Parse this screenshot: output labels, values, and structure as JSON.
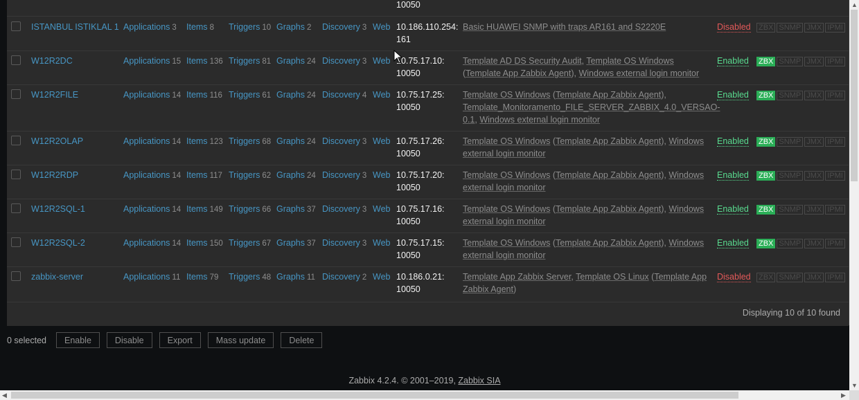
{
  "top_fragment": "10050",
  "rows": [
    {
      "name": "ISTANBUL ISTIKLAL 1",
      "apps": "3",
      "items": "8",
      "triggers": "10",
      "graphs": "2",
      "discovery": "3",
      "ip1": "10.186.110.254:",
      "ip2": "161",
      "templates": [
        {
          "text": "Basic HUAWEI SNMP with traps AR161 and S2220E",
          "link": true
        }
      ],
      "status": "Disabled",
      "zbx": false
    },
    {
      "name": "W12R2DC",
      "apps": "15",
      "items": "136",
      "triggers": "81",
      "graphs": "24",
      "discovery": "3",
      "ip1": "10.75.17.10:",
      "ip2": "10050",
      "templates": [
        {
          "text": "Template AD DS Security Audit",
          "link": true
        },
        {
          "text": ", ",
          "link": false
        },
        {
          "text": "Template OS Windows",
          "link": true
        },
        {
          "text": " (",
          "link": false
        },
        {
          "text": "Template App Zabbix Agent",
          "link": true
        },
        {
          "text": "), ",
          "link": false
        },
        {
          "text": "Windows external login monitor",
          "link": true
        }
      ],
      "status": "Enabled",
      "zbx": true
    },
    {
      "name": "W12R2FILE",
      "apps": "14",
      "items": "116",
      "triggers": "61",
      "graphs": "24",
      "discovery": "4",
      "ip1": "10.75.17.25:",
      "ip2": "10050",
      "templates": [
        {
          "text": "Template OS Windows",
          "link": true
        },
        {
          "text": " (",
          "link": false
        },
        {
          "text": "Template App Zabbix Agent",
          "link": true
        },
        {
          "text": "), ",
          "link": false
        },
        {
          "text": "Template_Monitoramento_FILE_SERVER_ZABBIX_4.0_VERSAO-0.1",
          "link": true
        },
        {
          "text": ", ",
          "link": false
        },
        {
          "text": "Windows external login monitor",
          "link": true
        }
      ],
      "status": "Enabled",
      "zbx": true
    },
    {
      "name": "W12R2OLAP",
      "apps": "14",
      "items": "123",
      "triggers": "68",
      "graphs": "24",
      "discovery": "3",
      "ip1": "10.75.17.26:",
      "ip2": "10050",
      "templates": [
        {
          "text": "Template OS Windows",
          "link": true
        },
        {
          "text": " (",
          "link": false
        },
        {
          "text": "Template App Zabbix Agent",
          "link": true
        },
        {
          "text": "), ",
          "link": false
        },
        {
          "text": "Windows external login monitor",
          "link": true
        }
      ],
      "status": "Enabled",
      "zbx": true
    },
    {
      "name": "W12R2RDP",
      "apps": "14",
      "items": "117",
      "triggers": "62",
      "graphs": "24",
      "discovery": "3",
      "ip1": "10.75.17.20:",
      "ip2": "10050",
      "templates": [
        {
          "text": "Template OS Windows",
          "link": true
        },
        {
          "text": " (",
          "link": false
        },
        {
          "text": "Template App Zabbix Agent",
          "link": true
        },
        {
          "text": "), ",
          "link": false
        },
        {
          "text": "Windows external login monitor",
          "link": true
        }
      ],
      "status": "Enabled",
      "zbx": true
    },
    {
      "name": "W12R2SQL-1",
      "apps": "14",
      "items": "149",
      "triggers": "66",
      "graphs": "37",
      "discovery": "3",
      "ip1": "10.75.17.16:",
      "ip2": "10050",
      "templates": [
        {
          "text": "Template OS Windows",
          "link": true
        },
        {
          "text": " (",
          "link": false
        },
        {
          "text": "Template App Zabbix Agent",
          "link": true
        },
        {
          "text": "), ",
          "link": false
        },
        {
          "text": "Windows external login monitor",
          "link": true
        }
      ],
      "status": "Enabled",
      "zbx": true
    },
    {
      "name": "W12R2SQL-2",
      "apps": "14",
      "items": "150",
      "triggers": "67",
      "graphs": "37",
      "discovery": "3",
      "ip1": "10.75.17.15:",
      "ip2": "10050",
      "templates": [
        {
          "text": "Template OS Windows",
          "link": true
        },
        {
          "text": " (",
          "link": false
        },
        {
          "text": "Template App Zabbix Agent",
          "link": true
        },
        {
          "text": "), ",
          "link": false
        },
        {
          "text": "Windows external login monitor",
          "link": true
        }
      ],
      "status": "Enabled",
      "zbx": true
    },
    {
      "name": "zabbix-server",
      "apps": "11",
      "items": "79",
      "triggers": "48",
      "graphs": "11",
      "discovery": "2",
      "ip1": "10.186.0.21:",
      "ip2": "10050",
      "templates": [
        {
          "text": "Template App Zabbix Server",
          "link": true
        },
        {
          "text": ", ",
          "link": false
        },
        {
          "text": "Template OS Linux",
          "link": true
        },
        {
          "text": " (",
          "link": false
        },
        {
          "text": "Template App Zabbix Agent",
          "link": true
        },
        {
          "text": ")",
          "link": false
        }
      ],
      "status": "Disabled",
      "zbx": false
    }
  ],
  "labels": {
    "applications": "Applications",
    "items": "Items",
    "triggers": "Triggers",
    "graphs": "Graphs",
    "discovery": "Discovery",
    "web": "Web",
    "zbx": "ZBX",
    "snmp": "SNMP",
    "jmx": "JMX",
    "ipmi": "IPMI"
  },
  "displaying": "Displaying 10 of 10 found",
  "selected": "0 selected",
  "buttons": [
    "Enable",
    "Disable",
    "Export",
    "Mass update",
    "Delete"
  ],
  "footer": {
    "text": "Zabbix 4.2.4. © 2001–2019, ",
    "link": "Zabbix SIA"
  },
  "colors": {
    "link": "#4796c4",
    "enabled": "#59db8f",
    "disabled": "#e45959",
    "zbx_badge": "#2bae57"
  }
}
